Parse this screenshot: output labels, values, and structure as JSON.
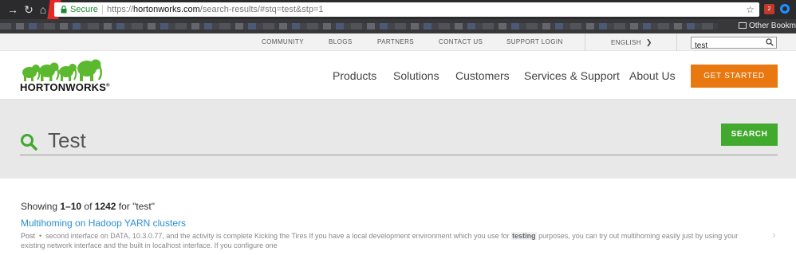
{
  "browser": {
    "secure_label": "Secure",
    "url_scheme": "https://",
    "url_domain": "hortonworks.com",
    "url_path": "/search-results/#stq=test&stp=1",
    "other_bookmarks": "Other Bookma",
    "ext_badge": "2"
  },
  "utility_nav": {
    "items": [
      "COMMUNITY",
      "BLOGS",
      "PARTNERS",
      "CONTACT US",
      "SUPPORT LOGIN"
    ],
    "language": "ENGLISH",
    "search_value": "test"
  },
  "header": {
    "logo_text": "HORTONWORKS",
    "logo_mark": "®",
    "nav": [
      "Products",
      "Solutions",
      "Customers",
      "Services & Support",
      "About Us"
    ],
    "cta_label": "GET STARTED"
  },
  "search": {
    "query": "Test",
    "button_label": "SEARCH"
  },
  "results": {
    "showing_prefix": "Showing ",
    "range": "1–10",
    "of_word": " of ",
    "total": "1242",
    "for_text": " for \"test\"",
    "items": [
      {
        "title": "Multihoming on Hadoop YARN clusters",
        "type": "Post",
        "snippet_before": "second interface on DATA, 10.3.0.77, and the activity is complete Kicking the Tires If you have a local development environment which you use for ",
        "highlight": "testing",
        "snippet_after": " purposes, you can try out multihoming easily just by using your existing network interface and the built in localhost interface. If you configure one"
      }
    ]
  },
  "colors": {
    "brand_green": "#41a92e",
    "cta_orange": "#e8780f",
    "link_blue": "#2a8fd1"
  }
}
